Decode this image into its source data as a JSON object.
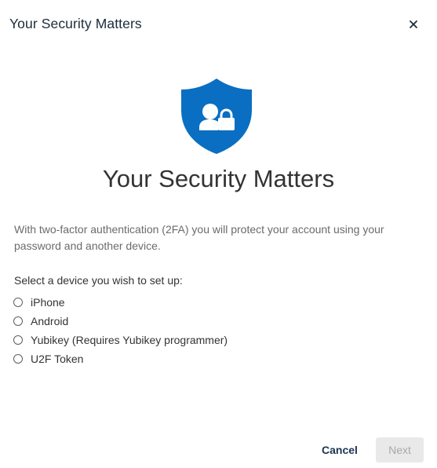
{
  "dialog": {
    "header_title": "Your Security Matters",
    "close_icon": "close-icon"
  },
  "hero": {
    "icon": "shield-user-lock-icon",
    "icon_color": "#0a6fc2",
    "title": "Your Security Matters"
  },
  "description": "With two-factor authentication (2FA) you will protect your account using your password and another device.",
  "device_select": {
    "prompt": "Select a device you wish to set up:",
    "options": [
      {
        "label": "iPhone",
        "selected": false
      },
      {
        "label": "Android",
        "selected": false
      },
      {
        "label": "Yubikey (Requires Yubikey programmer)",
        "selected": false
      },
      {
        "label": "U2F Token",
        "selected": false
      }
    ]
  },
  "footer": {
    "cancel_label": "Cancel",
    "next_label": "Next",
    "next_disabled": true
  }
}
